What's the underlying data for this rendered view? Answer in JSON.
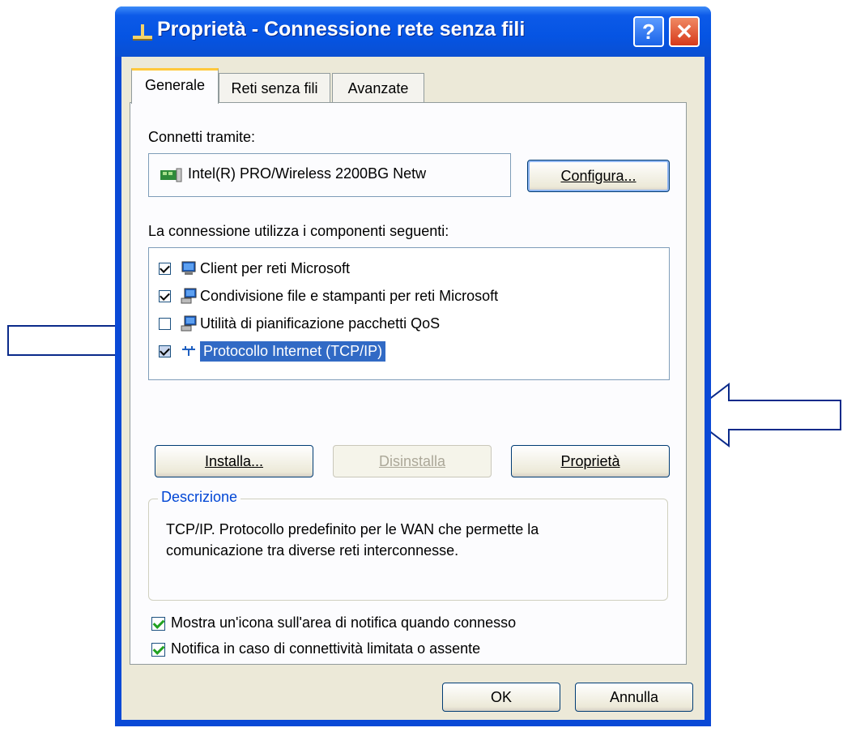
{
  "window": {
    "title": "Proprietà - Connessione rete senza fili",
    "help_label": "?",
    "close_label": "✕"
  },
  "tabs": [
    {
      "label": "Generale",
      "active": true
    },
    {
      "label": "Reti senza fili",
      "active": false
    },
    {
      "label": "Avanzate",
      "active": false
    }
  ],
  "connect_via": {
    "label": "Connetti tramite:",
    "adapter": "Intel(R) PRO/Wireless 2200BG Netw",
    "configure_button": "Configura..."
  },
  "components": {
    "label": "La connessione utilizza i componenti seguenti:",
    "items": [
      {
        "label": "Client per reti Microsoft",
        "checked": true,
        "icon": "network-client-icon",
        "selected": false
      },
      {
        "label": "Condivisione file e stampanti per reti Microsoft",
        "checked": true,
        "icon": "network-service-icon",
        "selected": false
      },
      {
        "label": "Utilità di pianificazione pacchetti QoS",
        "checked": false,
        "icon": "network-service-icon",
        "selected": false
      },
      {
        "label": "Protocollo Internet (TCP/IP)",
        "checked": true,
        "icon": "network-protocol-icon",
        "selected": true
      }
    ]
  },
  "buttons": {
    "install": "Installa...",
    "uninstall": "Disinstalla",
    "properties": "Proprietà",
    "ok": "OK",
    "cancel": "Annulla"
  },
  "description": {
    "title": "Descrizione",
    "text_line1": "TCP/IP. Protocollo predefinito per le WAN che permette la",
    "text_line2": "comunicazione tra diverse reti interconnesse."
  },
  "options": [
    {
      "label": "Mostra un'icona sull'area di notifica quando connesso",
      "checked": true
    },
    {
      "label": "Notifica in caso di connettività limitata o assente",
      "checked": true
    }
  ],
  "colors": {
    "titlebar": "#0554e3",
    "selection": "#316ac5",
    "active_tab_accent": "#ffc83c"
  }
}
